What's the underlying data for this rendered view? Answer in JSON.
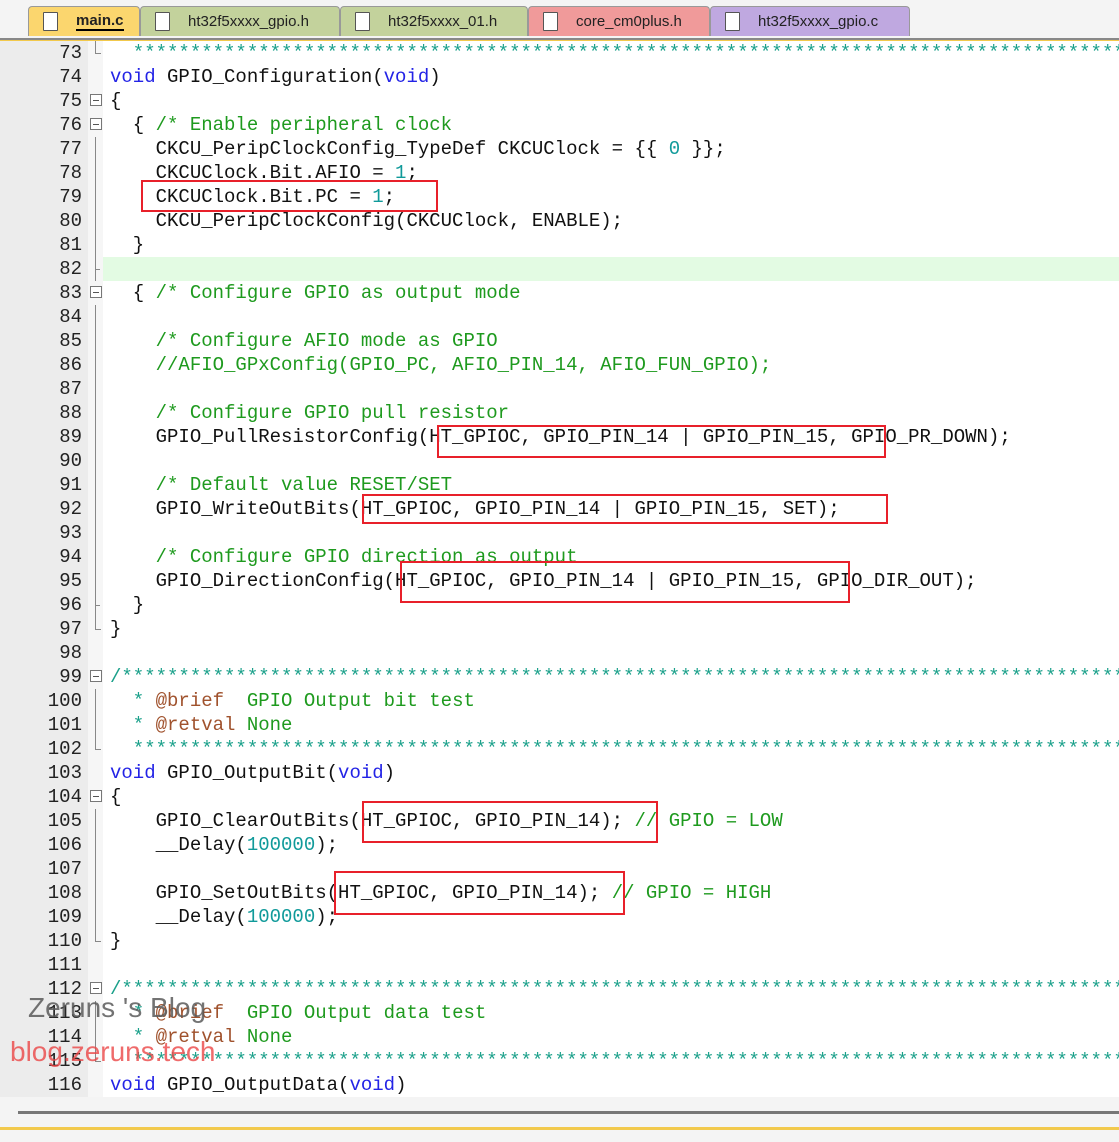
{
  "tabs": [
    {
      "label": "main.c",
      "color": "#fbd66e",
      "active": true
    },
    {
      "label": "ht32f5xxxx_gpio.h",
      "color": "#c3d29c"
    },
    {
      "label": "ht32f5xxxx_01.h",
      "color": "#c3d29c"
    },
    {
      "label": "core_cm0plus.h",
      "color": "#f09a9a"
    },
    {
      "label": "ht32f5xxxx_gpio.c",
      "color": "#bfa8e0"
    }
  ],
  "lines": [
    {
      "n": "73",
      "f": "end",
      "t": [
        [
          "  *******************************************************************************************",
          "s"
        ]
      ]
    },
    {
      "n": "74",
      "f": "none",
      "t": [
        [
          "void",
          "k"
        ],
        [
          " GPIO_Configuration(",
          "p"
        ],
        [
          "void",
          "k"
        ],
        [
          ")",
          "p"
        ]
      ]
    },
    {
      "n": "75",
      "f": "box",
      "t": [
        [
          "{",
          "p"
        ]
      ]
    },
    {
      "n": "76",
      "f": "box",
      "t": [
        [
          "  { ",
          "p"
        ],
        [
          "/* Enable peripheral clock",
          "c"
        ]
      ]
    },
    {
      "n": "77",
      "f": "line",
      "t": [
        [
          "    CKCU_PeripClockConfig_TypeDef CKCUClock = {{ ",
          "p"
        ],
        [
          "0",
          "n"
        ],
        [
          " }};",
          "p"
        ]
      ]
    },
    {
      "n": "78",
      "f": "line",
      "t": [
        [
          "    CKCUClock.Bit.AFIO = ",
          "p"
        ],
        [
          "1",
          "n"
        ],
        [
          ";",
          "p"
        ]
      ]
    },
    {
      "n": "79",
      "f": "line",
      "t": [
        [
          "    CKCUClock.Bit.PC = ",
          "p"
        ],
        [
          "1",
          "n"
        ],
        [
          ";",
          "p"
        ]
      ]
    },
    {
      "n": "80",
      "f": "line",
      "t": [
        [
          "    CKCU_PeripClockConfig(CKCUClock, ENABLE);",
          "p"
        ]
      ]
    },
    {
      "n": "81",
      "f": "line",
      "t": [
        [
          "  }",
          "p"
        ]
      ]
    },
    {
      "n": "82",
      "f": "tick",
      "hl": true,
      "t": []
    },
    {
      "n": "83",
      "f": "box",
      "t": [
        [
          "  { ",
          "p"
        ],
        [
          "/* Configure GPIO as output mode",
          "c"
        ]
      ]
    },
    {
      "n": "84",
      "f": "line",
      "t": []
    },
    {
      "n": "85",
      "f": "line",
      "t": [
        [
          "    ",
          "p"
        ],
        [
          "/* Configure AFIO mode as GPIO",
          "c"
        ]
      ]
    },
    {
      "n": "86",
      "f": "line",
      "t": [
        [
          "    ",
          "p"
        ],
        [
          "//AFIO_GPxConfig(GPIO_PC, AFIO_PIN_14, AFIO_FUN_GPIO);",
          "c"
        ]
      ]
    },
    {
      "n": "87",
      "f": "line",
      "t": []
    },
    {
      "n": "88",
      "f": "line",
      "t": [
        [
          "    ",
          "p"
        ],
        [
          "/* Configure GPIO pull resistor",
          "c"
        ]
      ]
    },
    {
      "n": "89",
      "f": "line",
      "t": [
        [
          "    GPIO_PullResistorConfig(HT_GPIOC, GPIO_PIN_14 | GPIO_PIN_15, GPIO_PR_DOWN);",
          "p"
        ]
      ]
    },
    {
      "n": "90",
      "f": "line",
      "t": []
    },
    {
      "n": "91",
      "f": "line",
      "t": [
        [
          "    ",
          "p"
        ],
        [
          "/* Default value RESET/SET",
          "c"
        ]
      ]
    },
    {
      "n": "92",
      "f": "line",
      "t": [
        [
          "    GPIO_WriteOutBits(HT_GPIOC, GPIO_PIN_14 | GPIO_PIN_15, SET);",
          "p"
        ]
      ]
    },
    {
      "n": "93",
      "f": "line",
      "t": []
    },
    {
      "n": "94",
      "f": "line",
      "t": [
        [
          "    ",
          "p"
        ],
        [
          "/* Configure GPIO direction as output",
          "c"
        ]
      ]
    },
    {
      "n": "95",
      "f": "line",
      "t": [
        [
          "    GPIO_DirectionConfig(HT_GPIOC, GPIO_PIN_14 | GPIO_PIN_15, GPIO_DIR_OUT);",
          "p"
        ]
      ]
    },
    {
      "n": "96",
      "f": "tick",
      "t": [
        [
          "  }",
          "p"
        ]
      ]
    },
    {
      "n": "97",
      "f": "end",
      "t": [
        [
          "}",
          "p"
        ]
      ]
    },
    {
      "n": "98",
      "f": "none",
      "t": []
    },
    {
      "n": "99",
      "f": "box",
      "t": [
        [
          "/*******************************************************************************************",
          "s"
        ]
      ]
    },
    {
      "n": "100",
      "f": "line",
      "t": [
        [
          "  * ",
          "s"
        ],
        [
          "@brief",
          "t"
        ],
        [
          "  GPIO Output bit test",
          "c"
        ]
      ]
    },
    {
      "n": "101",
      "f": "line",
      "t": [
        [
          "  * ",
          "s"
        ],
        [
          "@retval",
          "t"
        ],
        [
          " None",
          "c"
        ]
      ]
    },
    {
      "n": "102",
      "f": "end",
      "t": [
        [
          "  *******************************************************************************************",
          "s"
        ]
      ]
    },
    {
      "n": "103",
      "f": "none",
      "t": [
        [
          "void",
          "k"
        ],
        [
          " GPIO_OutputBit(",
          "p"
        ],
        [
          "void",
          "k"
        ],
        [
          ")",
          "p"
        ]
      ]
    },
    {
      "n": "104",
      "f": "box",
      "t": [
        [
          "{",
          "p"
        ]
      ]
    },
    {
      "n": "105",
      "f": "line",
      "t": [
        [
          "    GPIO_ClearOutBits(HT_GPIOC, GPIO_PIN_14); ",
          "p"
        ],
        [
          "// GPIO = LOW",
          "c"
        ]
      ]
    },
    {
      "n": "106",
      "f": "line",
      "t": [
        [
          "    __Delay(",
          "p"
        ],
        [
          "100000",
          "n"
        ],
        [
          ");",
          "p"
        ]
      ]
    },
    {
      "n": "107",
      "f": "line",
      "t": []
    },
    {
      "n": "108",
      "f": "line",
      "t": [
        [
          "    GPIO_SetOutBits(HT_GPIOC, GPIO_PIN_14); ",
          "p"
        ],
        [
          "// GPIO = HIGH",
          "c"
        ]
      ]
    },
    {
      "n": "109",
      "f": "line",
      "t": [
        [
          "    __Delay(",
          "p"
        ],
        [
          "100000",
          "n"
        ],
        [
          ");",
          "p"
        ]
      ]
    },
    {
      "n": "110",
      "f": "end",
      "t": [
        [
          "}",
          "p"
        ]
      ]
    },
    {
      "n": "111",
      "f": "none",
      "t": []
    },
    {
      "n": "112",
      "f": "box",
      "t": [
        [
          "/*******************************************************************************************",
          "s"
        ]
      ]
    },
    {
      "n": "113",
      "f": "line",
      "t": [
        [
          "  * ",
          "s"
        ],
        [
          "@brief",
          "t"
        ],
        [
          "  GPIO Output data test",
          "c"
        ]
      ]
    },
    {
      "n": "114",
      "f": "line",
      "t": [
        [
          "  * ",
          "s"
        ],
        [
          "@retval",
          "t"
        ],
        [
          " None",
          "c"
        ]
      ]
    },
    {
      "n": "115",
      "f": "end",
      "t": [
        [
          "  *******************************************************************************************",
          "s"
        ]
      ]
    },
    {
      "n": "116",
      "f": "none",
      "t": [
        [
          "void",
          "k"
        ],
        [
          " GPIO_OutputData(",
          "p"
        ],
        [
          "void",
          "k"
        ],
        [
          ")",
          "p"
        ]
      ]
    }
  ],
  "watermark": {
    "title": "Zeruns 's Blog",
    "url": "blog.zeruns.tech"
  }
}
